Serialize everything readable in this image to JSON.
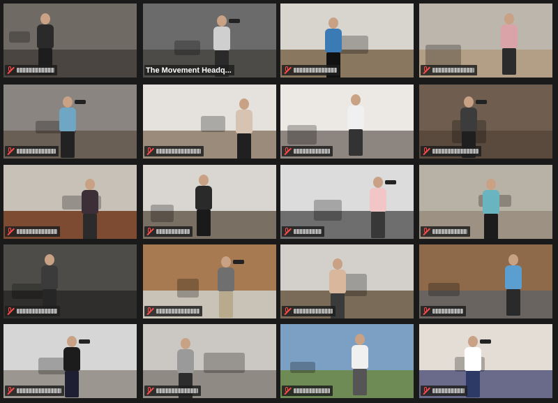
{
  "meeting": {
    "view": "gallery",
    "tiles": [
      {
        "name": "",
        "muted": true,
        "wall": "#6f6a63",
        "floor": "#4a4541",
        "shirt": "#2a2a2a",
        "pants": "#1d1d1d"
      },
      {
        "name": "The Movement Headq...",
        "muted": false,
        "wall": "#6b6b6b",
        "floor": "#4d4b48",
        "shirt": "#cfcfcf",
        "pants": "#2a2a2a"
      },
      {
        "name": "",
        "muted": true,
        "wall": "#d8d4ce",
        "floor": "#8a7760",
        "shirt": "#3a7bb5",
        "pants": "#111111"
      },
      {
        "name": "",
        "muted": true,
        "wall": "#bdb6ad",
        "floor": "#b39f86",
        "shirt": "#d9a3a8",
        "pants": "#2b2b2b"
      },
      {
        "name": "",
        "muted": true,
        "wall": "#8a8580",
        "floor": "#6a5f55",
        "shirt": "#6fa6c4",
        "pants": "#222222"
      },
      {
        "name": "",
        "muted": true,
        "wall": "#e5e2de",
        "floor": "#9a8b7b",
        "shirt": "#d7c3b2",
        "pants": "#202020"
      },
      {
        "name": "",
        "muted": true,
        "wall": "#ece9e5",
        "floor": "#8c8580",
        "shirt": "#f0f0f0",
        "pants": "#333333"
      },
      {
        "name": "",
        "muted": true,
        "wall": "#6f5e4f",
        "floor": "#5a4a3e",
        "shirt": "#3c3c3c",
        "pants": "#1f1f1f"
      },
      {
        "name": "",
        "muted": true,
        "wall": "#c8c1b8",
        "floor": "#7d4b32",
        "shirt": "#3d2f38",
        "pants": "#2b2b2b"
      },
      {
        "name": "",
        "muted": true,
        "wall": "#d9d6d1",
        "floor": "#7a6f63",
        "shirt": "#2a2a2a",
        "pants": "#1a1a1a"
      },
      {
        "name": "",
        "muted": true,
        "wall": "#dcdcdc",
        "floor": "#6e6e6e",
        "shirt": "#f2c6c6",
        "pants": "#383838",
        "active": true
      },
      {
        "name": "",
        "muted": true,
        "wall": "#b8b1a5",
        "floor": "#9d9183",
        "shirt": "#68b5c0",
        "pants": "#1c1c1c"
      },
      {
        "name": "",
        "muted": true,
        "wall": "#4d4c49",
        "floor": "#2f2e2c",
        "shirt": "#3b3b3b",
        "pants": "#262626"
      },
      {
        "name": "",
        "muted": true,
        "wall": "#a77a52",
        "floor": "#c9c2b6",
        "shirt": "#6f6f6f",
        "pants": "#b8aa8c"
      },
      {
        "name": "",
        "muted": true,
        "wall": "#d3d0cc",
        "floor": "#7a6a58",
        "shirt": "#d8b79c",
        "pants": "#3a3a3a"
      },
      {
        "name": "",
        "muted": true,
        "wall": "#8e6a4b",
        "floor": "#6a6460",
        "shirt": "#5b9fd0",
        "pants": "#2a2a2a"
      },
      {
        "name": "",
        "muted": true,
        "wall": "#d6d6d6",
        "floor": "#9b968f",
        "shirt": "#1c1c1c",
        "pants": "#1f1f33"
      },
      {
        "name": "",
        "muted": true,
        "wall": "#cbc7c2",
        "floor": "#8f8a84",
        "shirt": "#9a9a9a",
        "pants": "#2d2d2d"
      },
      {
        "name": "",
        "muted": true,
        "wall": "#7ba0c4",
        "floor": "#6e8a55",
        "shirt": "#f0f0f0",
        "pants": "#555555"
      },
      {
        "name": "",
        "muted": true,
        "wall": "#e3ddd5",
        "floor": "#6a6a8a",
        "shirt": "#ffffff",
        "pants": "#2d3a66"
      }
    ]
  }
}
